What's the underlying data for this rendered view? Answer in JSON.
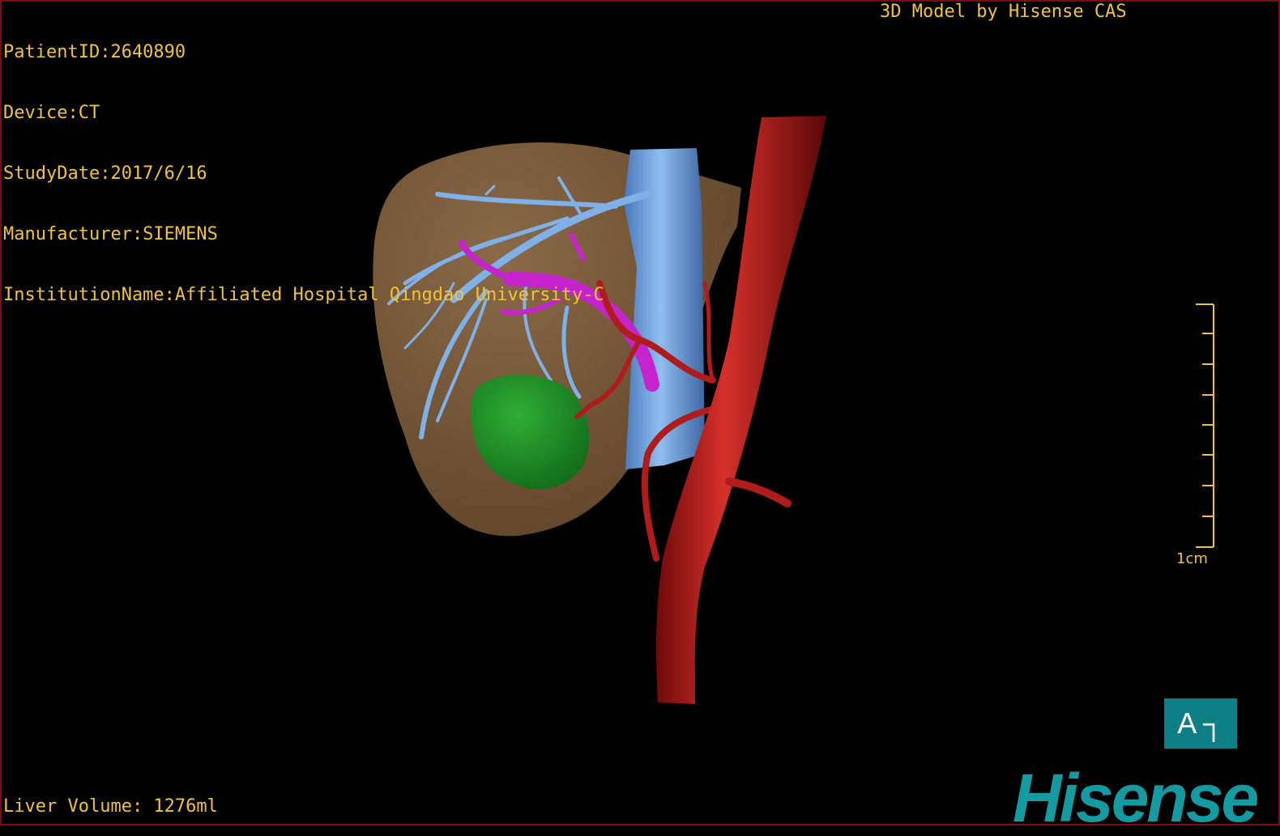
{
  "overlay": {
    "patient_id": "PatientID:2640890",
    "device": "Device:CT",
    "study_date": "StudyDate:2017/6/16",
    "manufacturer": "Manufacturer:SIEMENS",
    "institution": "InstitutionName:Affiliated Hospital Qingdao University-C",
    "credit": "3D Model by Hisense CAS",
    "liver_volume": "Liver Volume: 1276ml"
  },
  "scale_bar": {
    "label": "1cm"
  },
  "orientation": {
    "label": "A ┐"
  },
  "brand": {
    "logo_text": "Hisense"
  },
  "colors": {
    "text": "#f2c33a",
    "liver": "#7a5b3a",
    "veins": "#6f9fd8",
    "portal_vein": "#c020c8",
    "artery": "#c01c1c",
    "tumor": "#1f8f2a",
    "brand": "#149aa0"
  }
}
